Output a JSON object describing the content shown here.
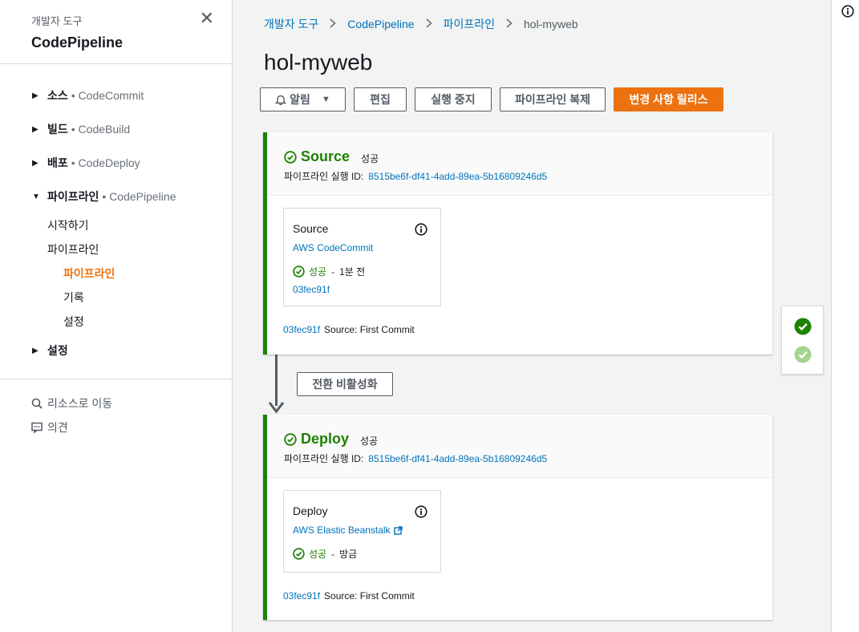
{
  "sidebar": {
    "subtitle": "개발자 도구",
    "title": "CodePipeline",
    "sections": [
      {
        "main": "소스",
        "service": "• CodeCommit"
      },
      {
        "main": "빌드",
        "service": "• CodeBuild"
      },
      {
        "main": "배포",
        "service": "• CodeDeploy"
      },
      {
        "main": "파이프라인",
        "service": "• CodePipeline"
      }
    ],
    "pipeline_items": [
      "시작하기",
      "파이프라인"
    ],
    "pipeline_sub_items": [
      "파이프라인",
      "기록",
      "설정"
    ],
    "settings": "설정",
    "utilities": {
      "go_to_resource": "리소스로 이동",
      "feedback": "의견"
    }
  },
  "breadcrumb": [
    "개발자 도구",
    "CodePipeline",
    "파이프라인",
    "hol-myweb"
  ],
  "page_title": "hol-myweb",
  "toolbar": {
    "notify": "알림",
    "edit": "편집",
    "stop": "실행 중지",
    "clone": "파이프라인 복제",
    "release": "변경 사항 릴리스"
  },
  "stages": [
    {
      "name": "Source",
      "status": "성공",
      "exec_label": "파이프라인 실행 ID:",
      "exec_id": "8515be6f-df41-4add-89ea-5b16809246d5",
      "action": {
        "name": "Source",
        "provider": "AWS CodeCommit",
        "status": "성공",
        "dash": "-",
        "time": "1분 전",
        "commit": "03fec91f"
      },
      "footer_commit": "03fec91f",
      "footer_message": "Source: First Commit"
    },
    {
      "name": "Deploy",
      "status": "성공",
      "exec_label": "파이프라인 실행 ID:",
      "exec_id": "8515be6f-df41-4add-89ea-5b16809246d5",
      "action": {
        "name": "Deploy",
        "provider": "AWS Elastic Beanstalk",
        "status": "성공",
        "dash": "-",
        "time": "방금"
      },
      "footer_commit": "03fec91f",
      "footer_message": "Source: First Commit"
    }
  ],
  "transition_button": "전환 비활성화",
  "colors": {
    "success": "#1d8102",
    "primary": "#ec7211",
    "link": "#0073bb"
  }
}
